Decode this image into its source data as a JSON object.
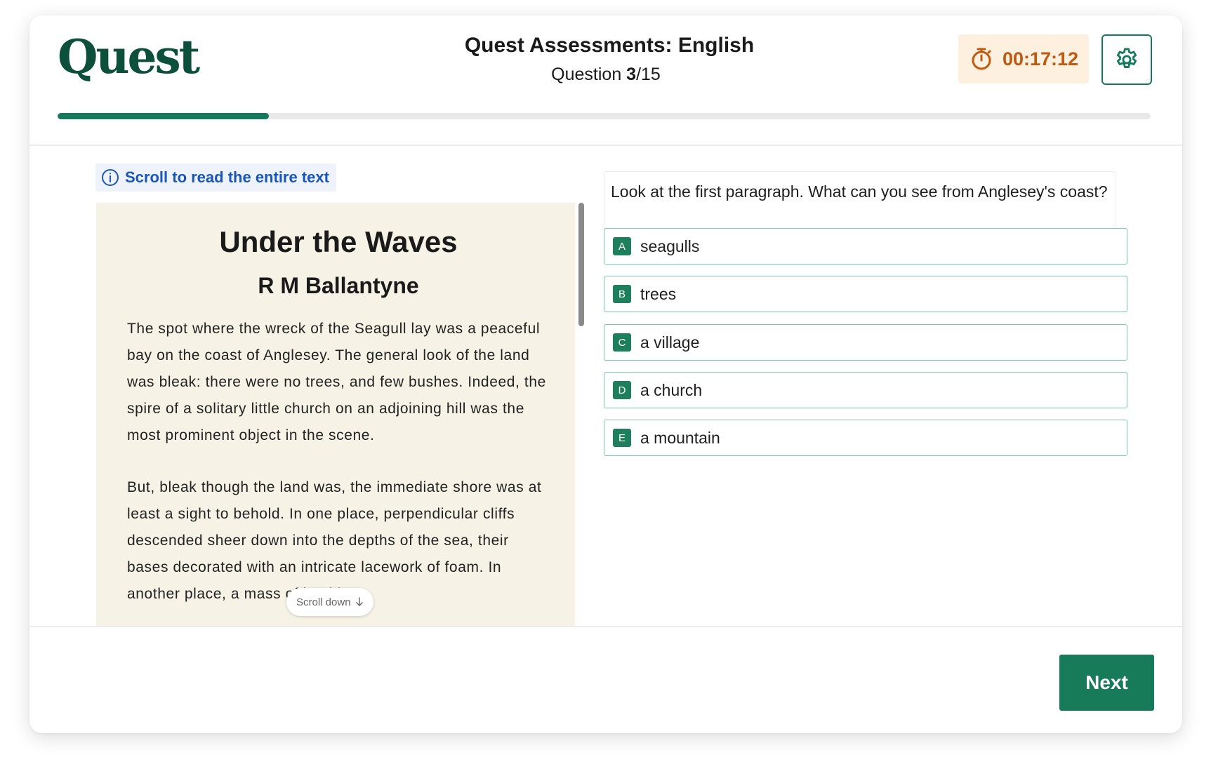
{
  "header": {
    "logo_text": "Quest",
    "title": "Quest Assessments: English",
    "question_prefix": "Question ",
    "question_current": "3",
    "question_total_suffix": "/15",
    "timer": "00:17:12",
    "progress_fraction": 0.1935
  },
  "passage": {
    "hint": "Scroll to read the entire text",
    "title": "Under the Waves",
    "author": "R M Ballantyne",
    "paragraphs": [
      "The spot where the wreck of the Seagull lay was a peaceful bay on the coast of Anglesey. The general look of the land was bleak: there were no trees, and few bushes. Indeed, the spire of a solitary little church on an adjoining hill was the most prominent object in the scene.",
      "But, bleak though the land was, the immediate shore was at least a sight to behold. In one place, perpendicular cliffs descended sheer down into the depths of the sea, their bases decorated with an intricate lacework of foam. In another place, a mass of boulders"
    ],
    "scroll_pill": "Scroll down"
  },
  "question": {
    "text": "Look at the first paragraph. What can you see from Anglesey's coast?",
    "options": [
      {
        "letter": "A",
        "label": "seagulls"
      },
      {
        "letter": "B",
        "label": "trees"
      },
      {
        "letter": "C",
        "label": "a village"
      },
      {
        "letter": "D",
        "label": "a church"
      },
      {
        "letter": "E",
        "label": "a mountain"
      }
    ]
  },
  "footer": {
    "next_label": "Next"
  },
  "icons": {
    "timer": "stopwatch-icon",
    "settings": "gear-icon",
    "hint": "info-icon",
    "scroll": "arrow-down-icon"
  },
  "colors": {
    "brand": "#0c4f3b",
    "accent": "#167a5a",
    "timer_text": "#c05a10",
    "timer_bg": "#fdf0df",
    "hint_text": "#1a55b8",
    "passage_bg": "#f6f2e6"
  }
}
